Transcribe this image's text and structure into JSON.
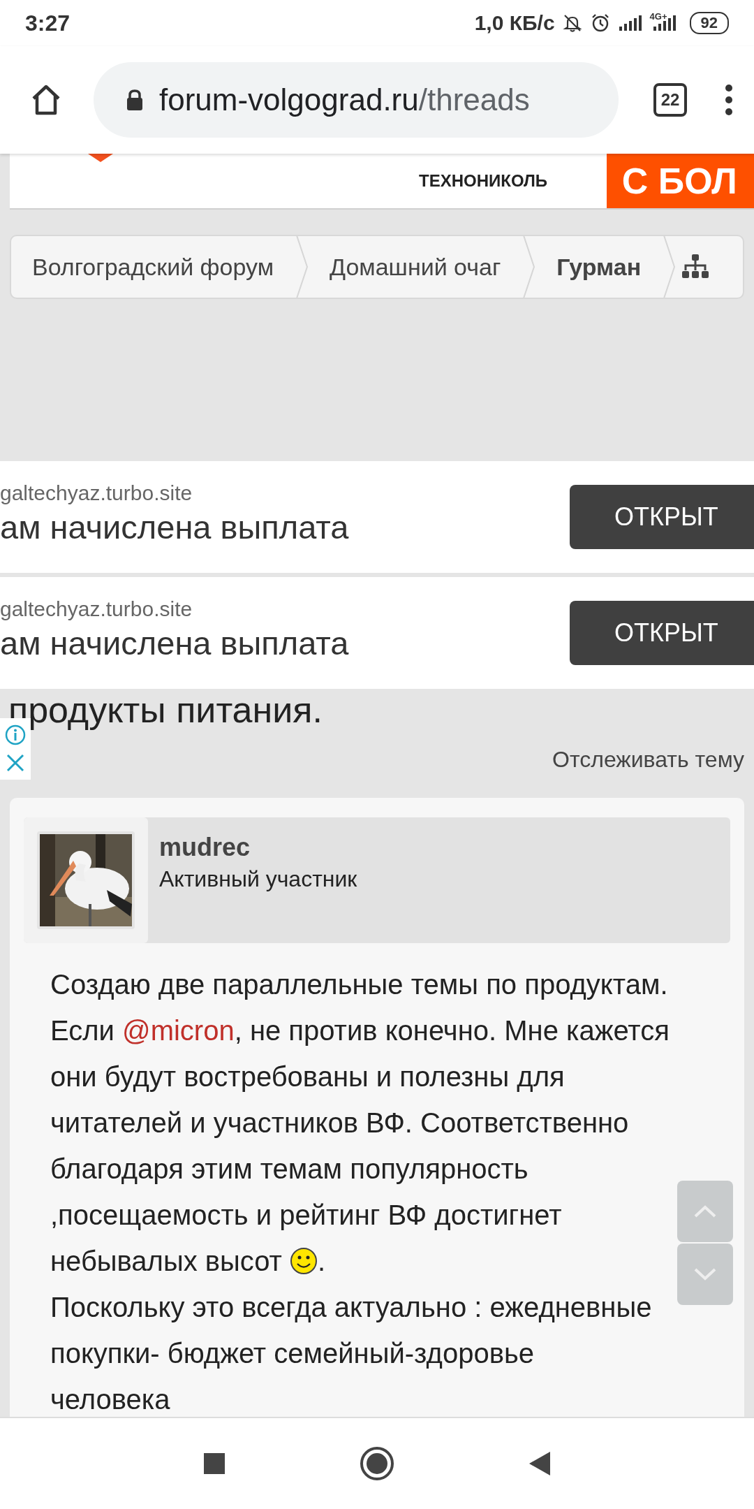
{
  "status_bar": {
    "time": "3:27",
    "speed": "1,0 КБ/с",
    "network": "4G+",
    "battery": "92"
  },
  "browser": {
    "url_host": "forum-volgograd.ru",
    "url_path": "/threads",
    "tab_count": "22"
  },
  "top_ad": {
    "brand": "ТЕХНОНИКОЛЬ",
    "cta": "С БОЛ"
  },
  "breadcrumb": [
    {
      "label": "Волгоградский форум",
      "selected": false
    },
    {
      "label": "Домашний очаг",
      "selected": false
    },
    {
      "label": "Гурман",
      "selected": true
    }
  ],
  "ads": [
    {
      "domain": "galtechyaz.turbo.site",
      "headline": "ам начислена выплата",
      "button": "ОТКРЫТ"
    },
    {
      "domain": "galtechyaz.turbo.site",
      "headline": "ам начислена выплата",
      "button": "ОТКРЫТ"
    }
  ],
  "thread": {
    "title": "продукты питания.",
    "watch": "Отслеживать тему"
  },
  "post": {
    "author": "mudrec",
    "role": "Активный участник",
    "body": [
      {
        "kind": "text",
        "text": "Создаю две параллельные темы по продуктам.\nЕсли "
      },
      {
        "kind": "mention",
        "text": "@micron"
      },
      {
        "kind": "text",
        "text": ", не против конечно. Мне кажется\nони будут востребованы и полезны для\nчитателей и участников ВФ. Соответственно\nблагодаря этим темам популярность\n,посещаемость и рейтинг ВФ достигнет\nнебывалых высот "
      },
      {
        "kind": "smiley"
      },
      {
        "kind": "text",
        "text": ".\nПоскольку это всегда актуально : ежедневные\nпокупки- бюджет семейный-здоровье\nчеловека"
      }
    ]
  }
}
